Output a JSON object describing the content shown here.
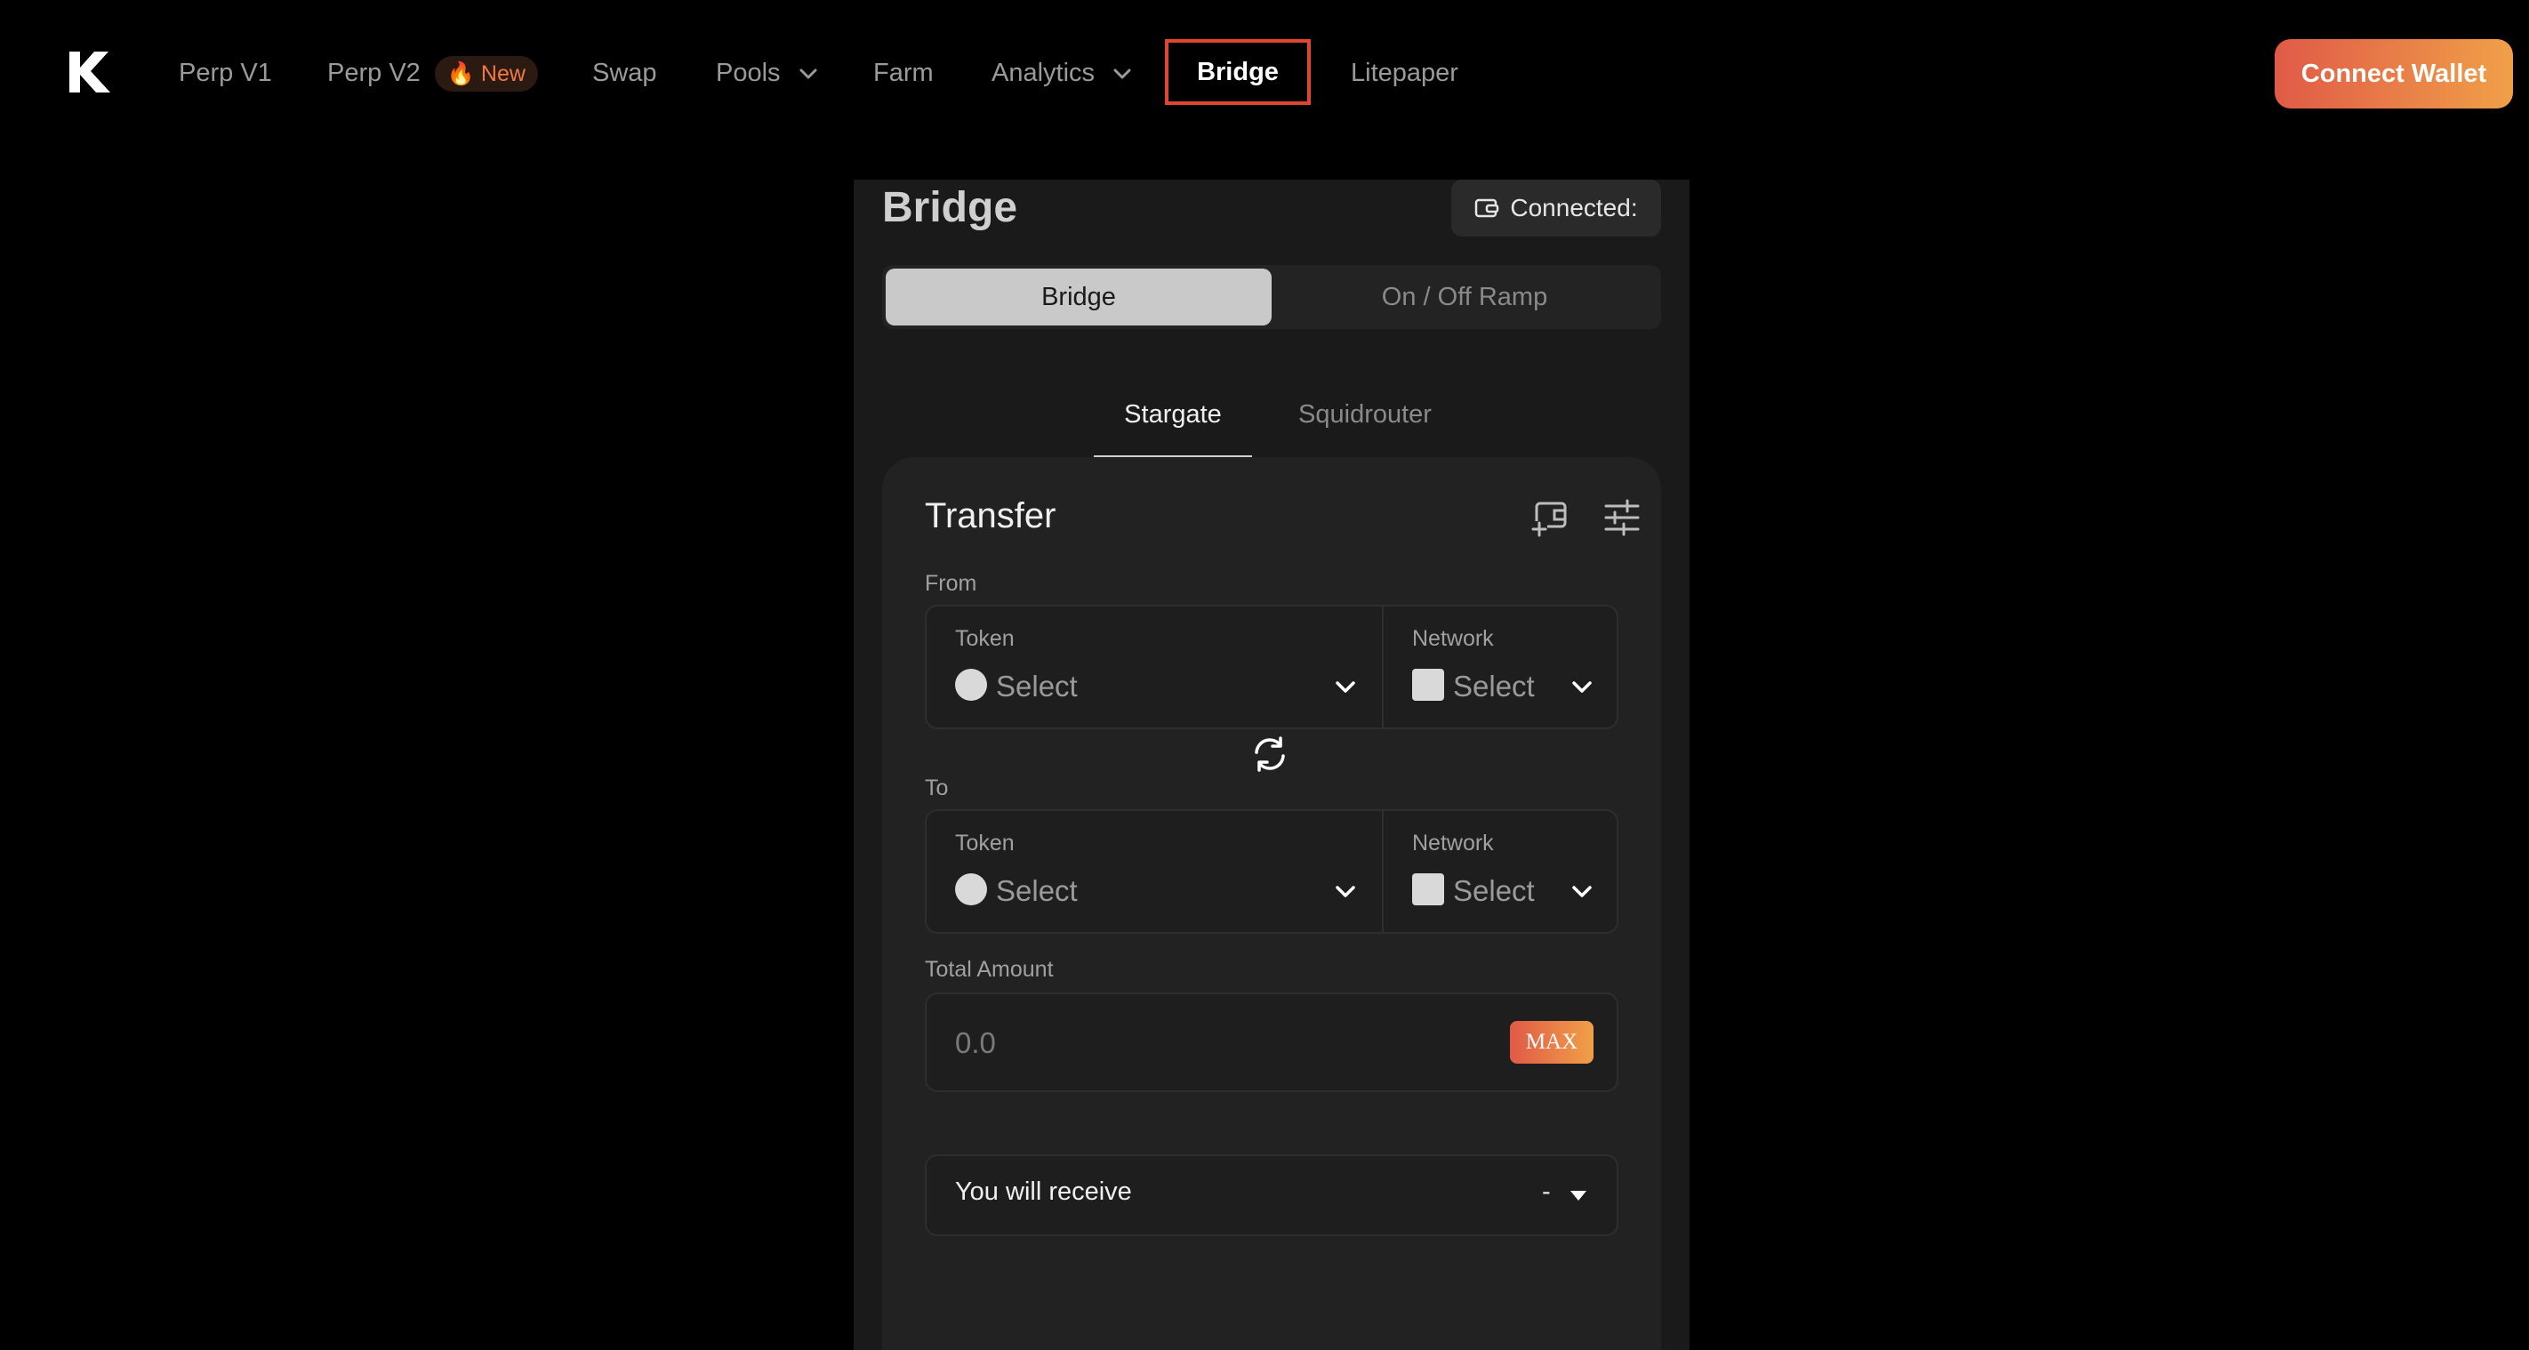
{
  "header": {
    "nav": [
      {
        "label": "Perp V1"
      },
      {
        "label": "Perp V2",
        "badge": "🔥 New"
      },
      {
        "label": "Swap"
      },
      {
        "label": "Pools",
        "icon": "chevron-down-icon"
      },
      {
        "label": "Farm"
      },
      {
        "label": "Analytics",
        "icon": "chevron-down-icon"
      },
      {
        "label": "Bridge",
        "active": true
      },
      {
        "label": "Litepaper"
      }
    ],
    "connect_label": "Connect Wallet",
    "logo_icon": "k-logo-icon"
  },
  "bridge": {
    "title": "Bridge",
    "connected_label": "Connected:",
    "modes": [
      "Bridge",
      "On / Off Ramp"
    ],
    "providers": [
      "Stargate",
      "Squidrouter"
    ],
    "transfer": {
      "title": "Transfer",
      "from_label": "From",
      "to_label": "To",
      "token_label": "Token",
      "network_label": "Network",
      "select_placeholder": "Select",
      "total_amount_label": "Total Amount",
      "amount_placeholder": "0.0",
      "max_label": "MAX",
      "receive_label": "You will receive",
      "receive_value": "-"
    }
  },
  "colors": {
    "background": "#000000",
    "panel": "#1a1a1a",
    "card": "#222222",
    "accent_start": "#e05a47",
    "accent_end": "#f0a048",
    "active_outline": "#e0452f"
  }
}
